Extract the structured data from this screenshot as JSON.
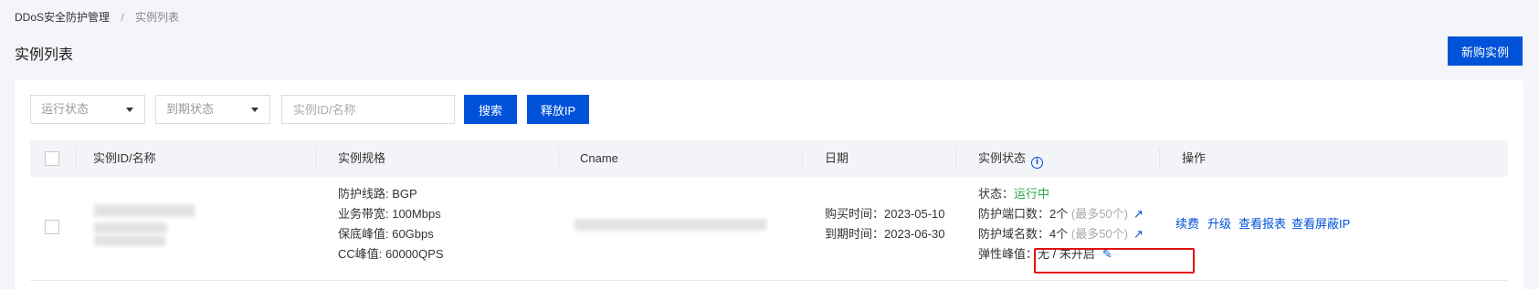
{
  "breadcrumb": {
    "root": "DDoS安全防护管理",
    "separator": "/",
    "current": "实例列表"
  },
  "page": {
    "title": "实例列表"
  },
  "toolbar": {
    "new_instance_label": "新购实例",
    "run_status_placeholder": "运行状态",
    "expire_status_placeholder": "到期状态",
    "search_placeholder": "实例ID/名称",
    "search_label": "搜索",
    "release_ip_label": "释放IP"
  },
  "table": {
    "headers": {
      "id": "实例ID/名称",
      "spec": "实例规格",
      "cname": "Cname",
      "date": "日期",
      "status": "实例状态",
      "actions": "操作"
    },
    "rows": [
      {
        "spec": {
          "line": "防护线路: BGP",
          "bandwidth": "业务带宽: 100Mbps",
          "guarantee": "保底峰值: 60Gbps",
          "cc": "CC峰值: 60000QPS"
        },
        "date": {
          "purchase": "购买时间：2023-05-10",
          "expire": "到期时间：2023-06-30"
        },
        "status": {
          "state_label": "状态：",
          "state_value": "运行中",
          "ports_label": "防护端口数：",
          "ports_value": "2个",
          "ports_limit": "(最多50个)",
          "domains_label": "防护域名数：",
          "domains_value": "4个",
          "domains_limit": "(最多50个)",
          "elastic_label": "弹性峰值：",
          "elastic_value": "无 / 未开启"
        },
        "actions": {
          "renew": "续费",
          "upgrade": "升级",
          "report": "查看报表",
          "blocked_ip": "查看屏蔽IP"
        }
      }
    ]
  },
  "colors": {
    "primary": "#0052d9",
    "running": "#29a64a",
    "highlight": "#e01010"
  },
  "icons": {
    "info": "info-circle-icon",
    "share": "share-arrow-icon",
    "edit": "pencil-edit-icon",
    "caret": "caret-down-icon"
  }
}
